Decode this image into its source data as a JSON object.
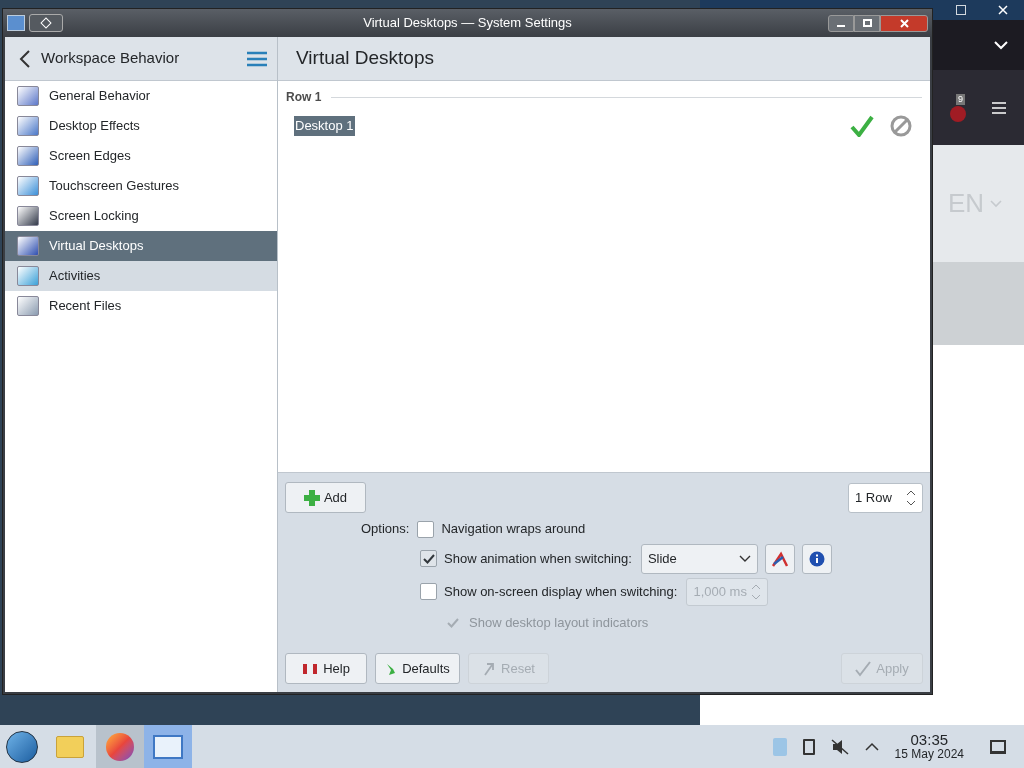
{
  "window": {
    "title": "Virtual Desktops — System Settings"
  },
  "sidebar": {
    "back_label": "Workspace Behavior",
    "items": [
      {
        "label": "General Behavior",
        "selected": false,
        "hovered": false
      },
      {
        "label": "Desktop Effects",
        "selected": false,
        "hovered": false
      },
      {
        "label": "Screen Edges",
        "selected": false,
        "hovered": false
      },
      {
        "label": "Touchscreen Gestures",
        "selected": false,
        "hovered": false
      },
      {
        "label": "Screen Locking",
        "selected": false,
        "hovered": false
      },
      {
        "label": "Virtual Desktops",
        "selected": true,
        "hovered": false
      },
      {
        "label": "Activities",
        "selected": false,
        "hovered": true
      },
      {
        "label": "Recent Files",
        "selected": false,
        "hovered": false
      }
    ]
  },
  "page": {
    "title": "Virtual Desktops",
    "rows": [
      {
        "label": "Row 1",
        "desktops": [
          {
            "name": "Desktop 1",
            "selected": true
          }
        ]
      }
    ],
    "add_button": "Add",
    "rows_spin": "1 Row",
    "options_label": "Options:",
    "options": [
      {
        "kind": "checkbox",
        "label": "Navigation wraps around",
        "checked": false,
        "disabled": false
      },
      {
        "kind": "combo",
        "label": "Show animation when switching:",
        "checked": true,
        "disabled": false,
        "value": "Slide"
      },
      {
        "kind": "spin",
        "label": "Show on-screen display when switching:",
        "checked": false,
        "disabled": false,
        "value": "1,000 ms"
      },
      {
        "kind": "sub",
        "label": "Show desktop layout indicators",
        "checked": true,
        "disabled": true
      }
    ],
    "buttons": [
      {
        "kind": "help",
        "label": "Help",
        "disabled": false
      },
      {
        "kind": "defaults",
        "label": "Defaults",
        "disabled": false
      },
      {
        "kind": "reset",
        "label": "Reset",
        "disabled": true
      },
      {
        "kind": "apply",
        "label": "Apply",
        "disabled": true
      }
    ]
  },
  "background_browser": {
    "badge": "9",
    "language": "EN"
  },
  "taskbar": {
    "time": "03:35",
    "date": "15 May 2024"
  }
}
